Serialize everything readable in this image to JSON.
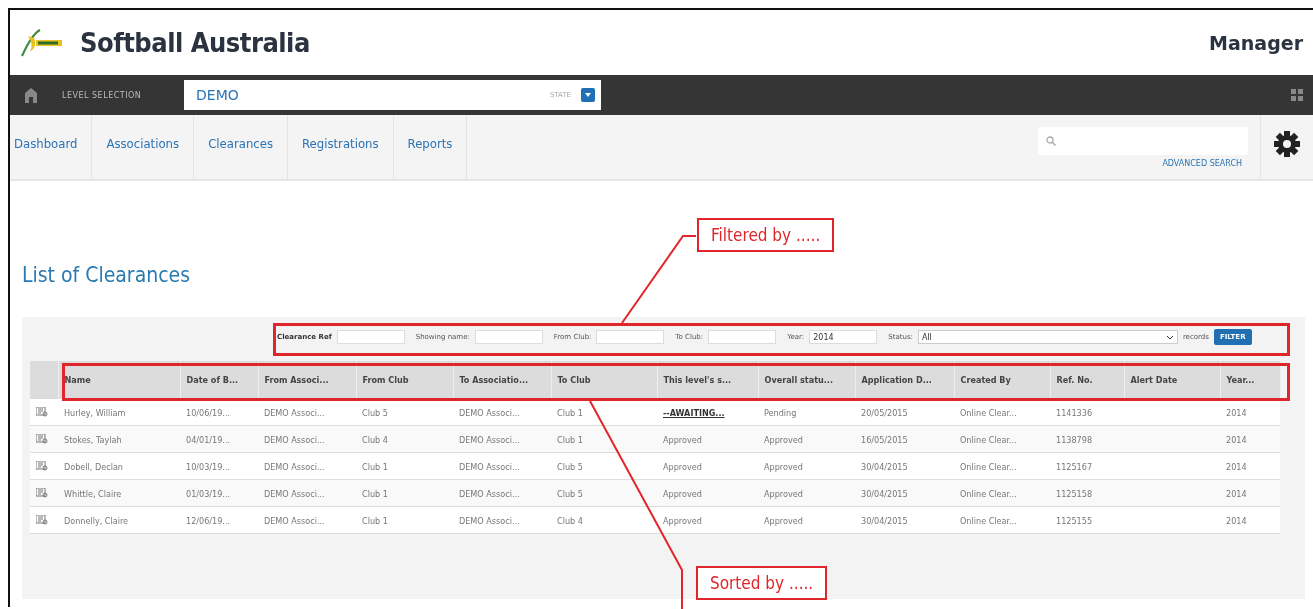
{
  "header": {
    "title": "Softball Australia",
    "user": "Manager"
  },
  "level_bar": {
    "label": "LEVEL SELECTION",
    "value": "DEMO",
    "state_label": "STATE"
  },
  "nav": {
    "tabs": [
      "Dashboard",
      "Associations",
      "Clearances",
      "Registrations",
      "Reports"
    ],
    "advanced_search": "ADVANCED SEARCH"
  },
  "page_title": "List of Clearances",
  "filter": {
    "fields": [
      {
        "label": "Clearance Ref",
        "bold": true
      },
      {
        "label": "Showing name:",
        "bold": false
      },
      {
        "label": "From Club:",
        "bold": false
      },
      {
        "label": "To Club:",
        "bold": false
      },
      {
        "label": "Year:",
        "value": "2014",
        "bold": false
      }
    ],
    "status_label": "Status:",
    "status_value": "All",
    "records_label": "records",
    "button": "FILTER"
  },
  "table": {
    "columns": [
      "Name",
      "Date of B...",
      "From Associ...",
      "From Club",
      "To Associatio...",
      "To Club",
      "This level's s...",
      "Overall statu...",
      "Application D...",
      "Created By",
      "Ref. No.",
      "Alert Date",
      "Year..."
    ],
    "rows": [
      {
        "awaiting": true,
        "cells": [
          "Hurley, William",
          "10/06/19...",
          "DEMO Associ...",
          "Club 5",
          "DEMO Associ...",
          "Club 1",
          "--AWAITING...",
          "Pending",
          "20/05/2015",
          "Online Clear...",
          "1141336",
          "",
          "2014"
        ]
      },
      {
        "awaiting": false,
        "cells": [
          "Stokes, Taylah",
          "04/01/19...",
          "DEMO Associ...",
          "Club 4",
          "DEMO Associ...",
          "Club 1",
          "Approved",
          "Approved",
          "16/05/2015",
          "Online Clear...",
          "1138798",
          "",
          "2014"
        ]
      },
      {
        "awaiting": false,
        "cells": [
          "Dobell, Declan",
          "10/03/19...",
          "DEMO Associ...",
          "Club 1",
          "DEMO Associ...",
          "Club 5",
          "Approved",
          "Approved",
          "30/04/2015",
          "Online Clear...",
          "1125167",
          "",
          "2014"
        ]
      },
      {
        "awaiting": false,
        "cells": [
          "Whittle, Claire",
          "01/03/19...",
          "DEMO Associ...",
          "Club 1",
          "DEMO Associ...",
          "Club 5",
          "Approved",
          "Approved",
          "30/04/2015",
          "Online Clear...",
          "1125158",
          "",
          "2014"
        ]
      },
      {
        "awaiting": false,
        "cells": [
          "Donnelly, Claire",
          "12/06/19...",
          "DEMO Associ...",
          "Club 1",
          "DEMO Associ...",
          "Club 4",
          "Approved",
          "Approved",
          "30/04/2015",
          "Online Clear...",
          "1125155",
          "",
          "2014"
        ]
      }
    ]
  },
  "annotations": [
    {
      "kind": "filter",
      "text": "Filtered by ....."
    },
    {
      "kind": "sort",
      "text": "Sorted by ....."
    }
  ]
}
